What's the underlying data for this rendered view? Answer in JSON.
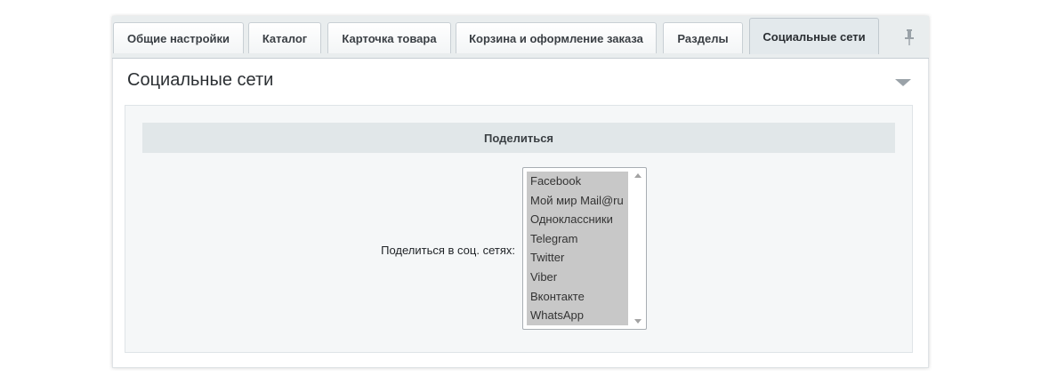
{
  "tabs": [
    {
      "label": "Общие настройки",
      "active": false
    },
    {
      "label": "Каталог",
      "active": false
    },
    {
      "label": "Карточка товара",
      "active": false
    },
    {
      "label": "Корзина и оформление заказа",
      "active": false
    },
    {
      "label": "Разделы",
      "active": false
    },
    {
      "label": "Социальные сети",
      "active": true
    }
  ],
  "pin_icon": "pin-icon",
  "section": {
    "title": "Социальные сети",
    "collapse_icon": "triangle-down-icon"
  },
  "group": {
    "header": "Поделиться",
    "field_label": "Поделиться в соц. сетях:",
    "options": [
      "Facebook",
      "Мой мир Mail@ru",
      "Одноклассники",
      "Telegram",
      "Twitter",
      "Viber",
      "Вконтакте",
      "WhatsApp"
    ]
  },
  "colors": {
    "tabbar_bg": "#e9edee",
    "active_tab_bg": "#e3e9ec",
    "group_header_bg": "#e1e7e9",
    "selected_option_bg": "#c8c8c8"
  }
}
